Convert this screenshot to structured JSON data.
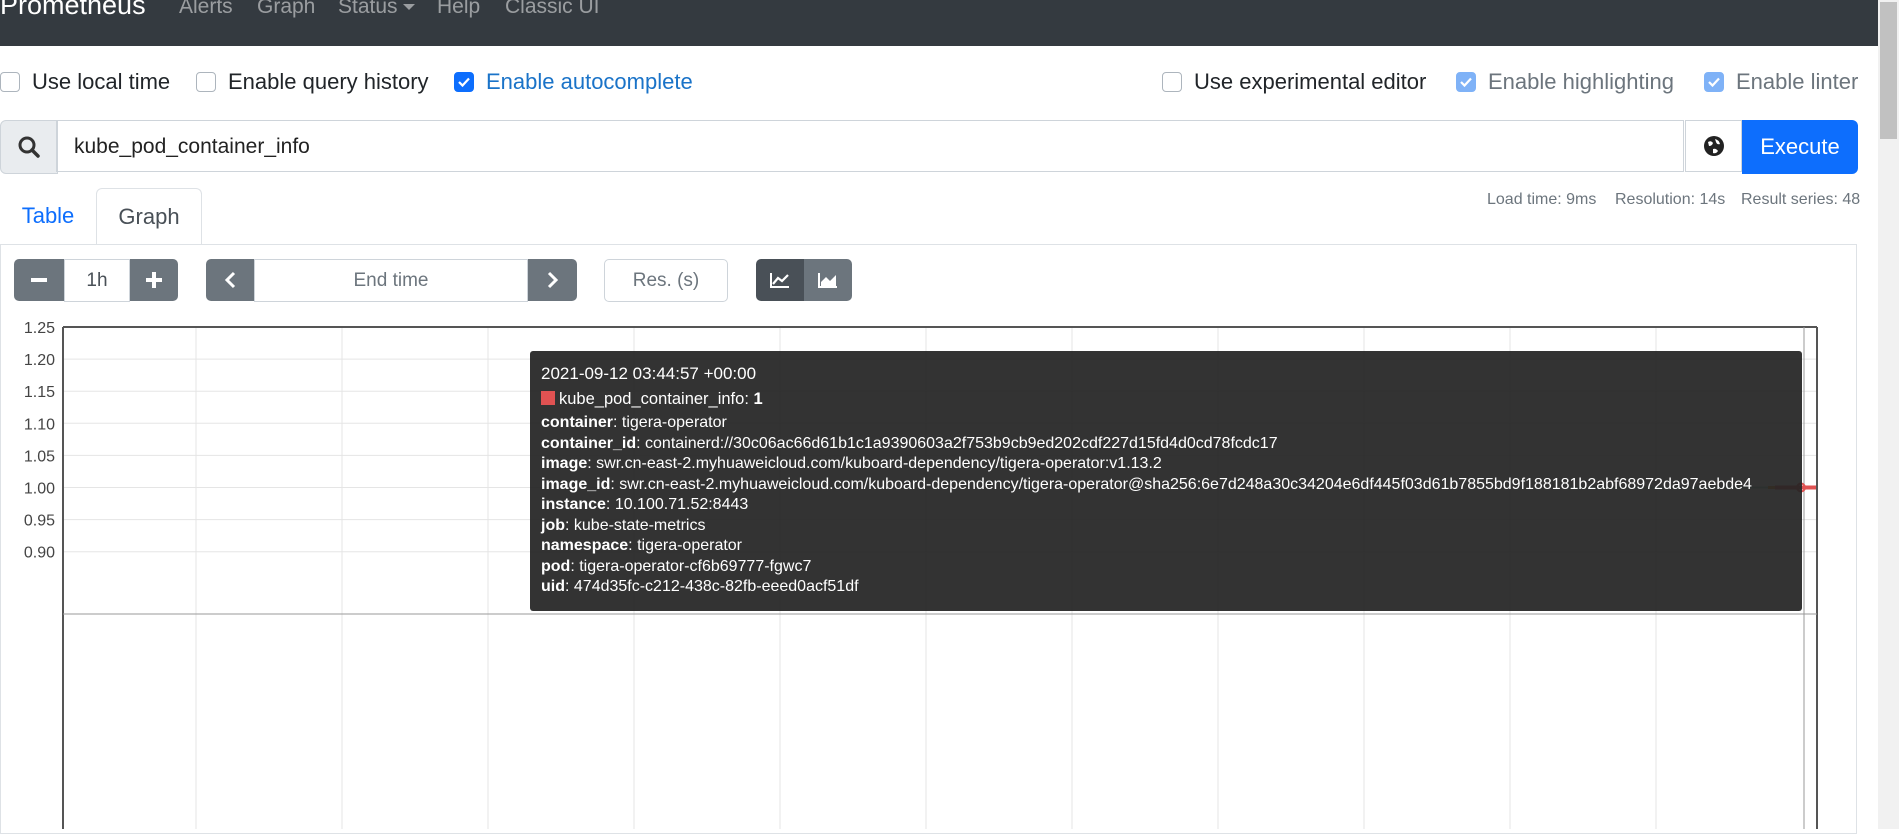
{
  "navbar": {
    "brand": "Prometheus",
    "links": [
      "Alerts",
      "Graph",
      "Status",
      "Help",
      "Classic UI"
    ]
  },
  "options": {
    "use_local_time": {
      "label": "Use local time",
      "checked": false
    },
    "enable_query_history": {
      "label": "Enable query history",
      "checked": false
    },
    "enable_autocomplete": {
      "label": "Enable autocomplete",
      "checked": true
    },
    "use_experimental_editor": {
      "label": "Use experimental editor",
      "checked": false
    },
    "enable_highlighting": {
      "label": "Enable highlighting",
      "checked": true
    },
    "enable_linter": {
      "label": "Enable linter",
      "checked": true
    }
  },
  "query": {
    "expression": "kube_pod_container_info",
    "execute_label": "Execute"
  },
  "tabs": {
    "table": "Table",
    "graph": "Graph"
  },
  "stats": {
    "load_time": "Load time: 9ms",
    "resolution": "Resolution: 14s",
    "result_series": "Result series: 48"
  },
  "controls": {
    "range": "1h",
    "end_time_placeholder": "End time",
    "resolution_placeholder": "Res. (s)"
  },
  "chart_data": {
    "type": "line",
    "y_ticks": [
      "1.25",
      "1.20",
      "1.15",
      "1.10",
      "1.05",
      "1.00",
      "0.95",
      "0.90"
    ],
    "ylim": [
      0.86,
      1.25
    ],
    "grid": true,
    "series": [
      {
        "name": "kube_pod_container_info",
        "value": 1
      }
    ]
  },
  "tooltip": {
    "timestamp": "2021-09-12 03:44:57 +00:00",
    "series_name": "kube_pod_container_info",
    "value": "1",
    "labels": [
      {
        "key": "container",
        "value": "tigera-operator"
      },
      {
        "key": "container_id",
        "value": "containerd://30c06ac66d61b1c1a9390603a2f753b9cb9ed202cdf227d15fd4d0cd78fcdc17"
      },
      {
        "key": "image",
        "value": "swr.cn-east-2.myhuaweicloud.com/kuboard-dependency/tigera-operator:v1.13.2"
      },
      {
        "key": "image_id",
        "value": "swr.cn-east-2.myhuaweicloud.com/kuboard-dependency/tigera-operator@sha256:6e7d248a30c34204e6df445f03d61b7855bd9f188181b2abf68972da97aebde4"
      },
      {
        "key": "instance",
        "value": "10.100.71.52:8443"
      },
      {
        "key": "job",
        "value": "kube-state-metrics"
      },
      {
        "key": "namespace",
        "value": "tigera-operator"
      },
      {
        "key": "pod",
        "value": "tigera-operator-cf6b69777-fgwc7"
      },
      {
        "key": "uid",
        "value": "474d35fc-c212-438c-82fb-eeed0acf51df"
      }
    ]
  },
  "colors": {
    "navbar": "#343a40",
    "primary": "#0d6efd",
    "series": "#e05252"
  }
}
